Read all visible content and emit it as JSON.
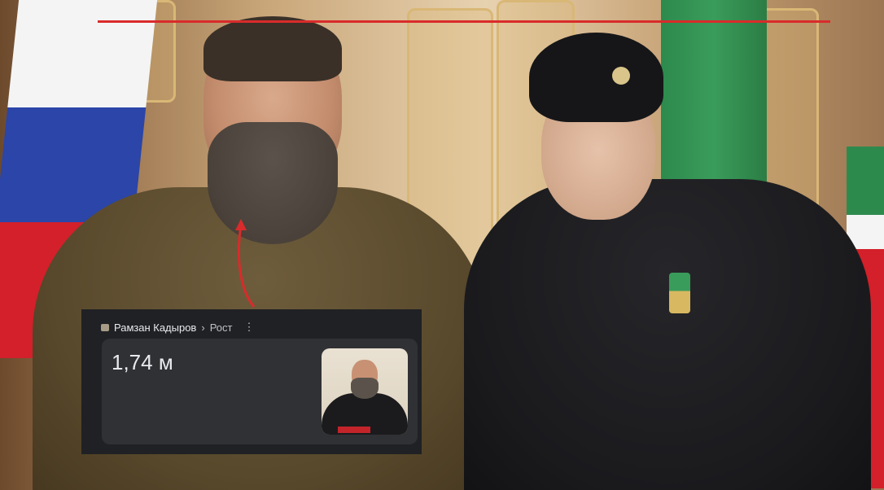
{
  "overlay_card": {
    "site_name": "Рамзан Кадыров",
    "breadcrumb_separator": "›",
    "breadcrumb_topic": "Рост",
    "more_icon": "more-vert-icon",
    "answer": "1,74 м",
    "thumbnail_icon": "portrait-thumbnail"
  },
  "colors": {
    "annotation_red": "#d92b2b",
    "card_bg": "#202124",
    "answer_box_bg": "#303134",
    "text_primary": "#e8eaed"
  }
}
